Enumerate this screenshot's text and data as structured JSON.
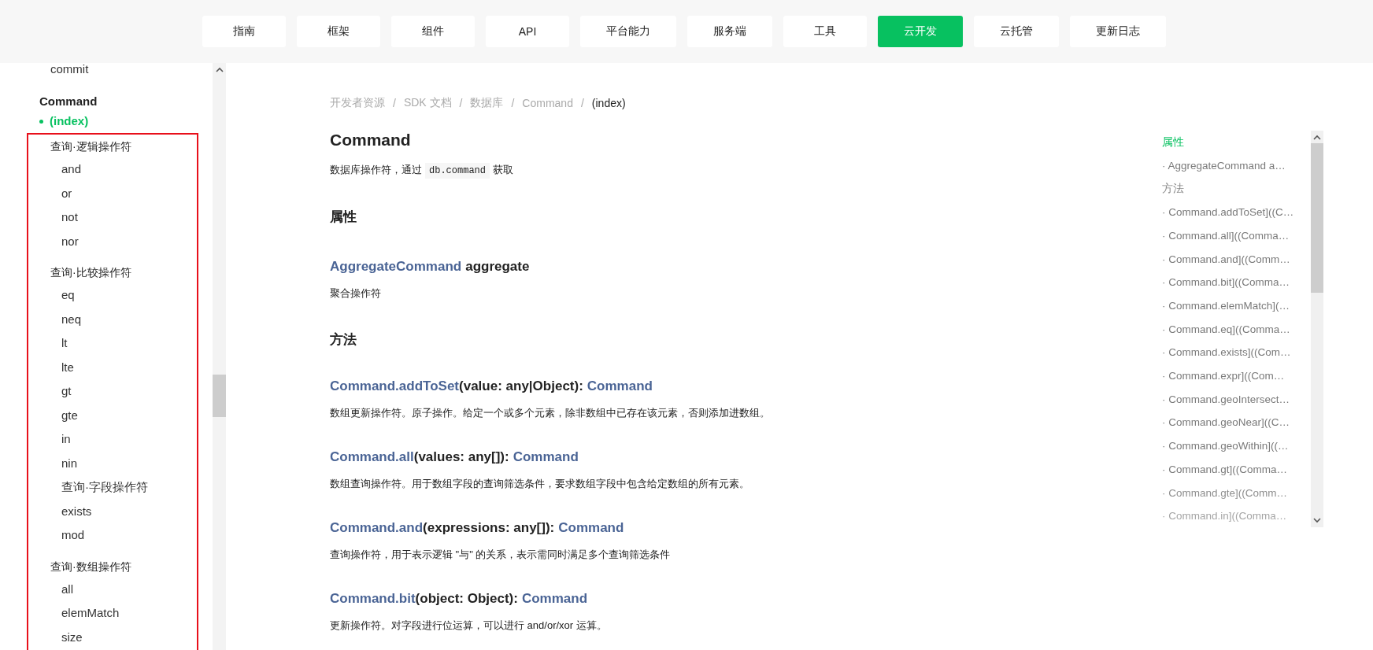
{
  "nav": [
    {
      "label": "指南",
      "selected": false
    },
    {
      "label": "框架",
      "selected": false
    },
    {
      "label": "组件",
      "selected": false
    },
    {
      "label": "API",
      "selected": false
    },
    {
      "label": "平台能力",
      "selected": false
    },
    {
      "label": "服务端",
      "selected": false
    },
    {
      "label": "工具",
      "selected": false
    },
    {
      "label": "云开发",
      "selected": true
    },
    {
      "label": "云托管",
      "selected": false
    },
    {
      "label": "更新日志",
      "selected": false
    }
  ],
  "sidebar": {
    "items": [
      {
        "label": "commit",
        "kind": "leaf",
        "selected": false
      },
      {
        "label": "Command",
        "kind": "section",
        "selected": false
      },
      {
        "label": "(index)",
        "kind": "bullet",
        "selected": true
      }
    ],
    "highlighted_groups": [
      {
        "label": "查询·逻辑操作符",
        "children": [
          {
            "label": "and",
            "selected": false
          },
          {
            "label": "or",
            "selected": false
          },
          {
            "label": "not",
            "selected": false
          },
          {
            "label": "nor",
            "selected": false
          }
        ]
      },
      {
        "label": "查询·比较操作符",
        "children": [
          {
            "label": "eq",
            "selected": false
          },
          {
            "label": "neq",
            "selected": false
          },
          {
            "label": "lt",
            "selected": false
          },
          {
            "label": "lte",
            "selected": false
          },
          {
            "label": "gt",
            "selected": false
          },
          {
            "label": "gte",
            "selected": false
          },
          {
            "label": "in",
            "selected": false
          },
          {
            "label": "nin",
            "selected": false
          },
          {
            "label": "查询·字段操作符",
            "selected": false
          },
          {
            "label": "exists",
            "selected": false
          },
          {
            "label": "mod",
            "selected": false
          }
        ]
      },
      {
        "label": "查询·数组操作符",
        "children": [
          {
            "label": "all",
            "selected": false
          },
          {
            "label": "elemMatch",
            "selected": false
          },
          {
            "label": "size",
            "selected": false
          }
        ]
      }
    ]
  },
  "breadcrumb": {
    "separator": "/",
    "items": [
      {
        "label": "开发者资源",
        "current": false
      },
      {
        "label": "SDK 文档",
        "current": false
      },
      {
        "label": "数据库",
        "current": false
      },
      {
        "label": "Command",
        "current": false
      },
      {
        "label": "(index)",
        "current": true
      }
    ]
  },
  "article": {
    "title": "Command",
    "intro": {
      "before": "数据库操作符，通过",
      "code": "db.command",
      "after": "获取"
    },
    "properties_heading": "属性",
    "properties": [
      {
        "type": "AggregateCommand",
        "name": "aggregate",
        "description": "聚合操作符"
      }
    ],
    "methods_heading": "方法",
    "methods": [
      {
        "name": "Command.addToSet",
        "params": "(value: any|Object):",
        "returns": "Command",
        "description": "数组更新操作符。原子操作。给定一个或多个元素，除非数组中已存在该元素，否则添加进数组。"
      },
      {
        "name": "Command.all",
        "params": "(values: any[]):",
        "returns": "Command",
        "description": "数组查询操作符。用于数组字段的查询筛选条件，要求数组字段中包含给定数组的所有元素。"
      },
      {
        "name": "Command.and",
        "params": "(expressions: any[]):",
        "returns": "Command",
        "description": "查询操作符，用于表示逻辑 \"与\" 的关系，表示需同时满足多个查询筛选条件"
      },
      {
        "name": "Command.bit",
        "params": "(object: Object):",
        "returns": "Command",
        "description": "更新操作符。对字段进行位运算，可以进行 and/or/xor 运算。"
      }
    ]
  },
  "toc": [
    {
      "label": "属性",
      "kind": "heading",
      "selected": true
    },
    {
      "label": "· AggregateCommand a…",
      "kind": "entry",
      "selected": false
    },
    {
      "label": "方法",
      "kind": "heading",
      "selected": false
    },
    {
      "label": "· Command.addToSet]((C…",
      "kind": "entry",
      "selected": false
    },
    {
      "label": "· Command.all]((Comma…",
      "kind": "entry",
      "selected": false
    },
    {
      "label": "· Command.and]((Comm…",
      "kind": "entry",
      "selected": false
    },
    {
      "label": "· Command.bit]((Comma…",
      "kind": "entry",
      "selected": false
    },
    {
      "label": "· Command.elemMatch](…",
      "kind": "entry",
      "selected": false
    },
    {
      "label": "· Command.eq]((Comma…",
      "kind": "entry",
      "selected": false
    },
    {
      "label": "· Command.exists]((Com…",
      "kind": "entry",
      "selected": false
    },
    {
      "label": "· Command.expr]((Com…",
      "kind": "entry",
      "selected": false
    },
    {
      "label": "· Command.geoIntersect…",
      "kind": "entry",
      "selected": false
    },
    {
      "label": "· Command.geoNear]((C…",
      "kind": "entry",
      "selected": false
    },
    {
      "label": "· Command.geoWithin]((…",
      "kind": "entry",
      "selected": false
    },
    {
      "label": "· Command.gt]((Comma…",
      "kind": "entry",
      "selected": false
    },
    {
      "label": "· Command.gte]((Comm…",
      "kind": "entry",
      "selected": false
    },
    {
      "label": "· Command.in]((Comma…",
      "kind": "entry",
      "selected": false
    }
  ]
}
